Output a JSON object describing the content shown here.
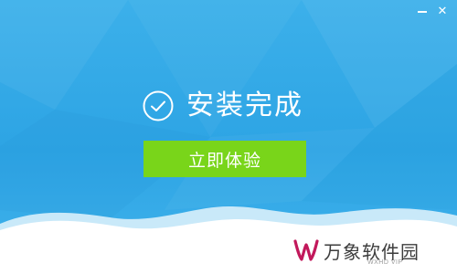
{
  "window": {
    "minimize_label": "—",
    "close_label": "✕"
  },
  "status": {
    "title": "安装完成",
    "icon": "check-circle-icon"
  },
  "action": {
    "button_label": "立即体验",
    "color": "#79d51a"
  },
  "watermark": {
    "name": "万象软件园",
    "sub": "WXHD VIP",
    "logo_text": "W"
  },
  "colors": {
    "background": "#2da4e4",
    "wave": "#ffffff"
  }
}
